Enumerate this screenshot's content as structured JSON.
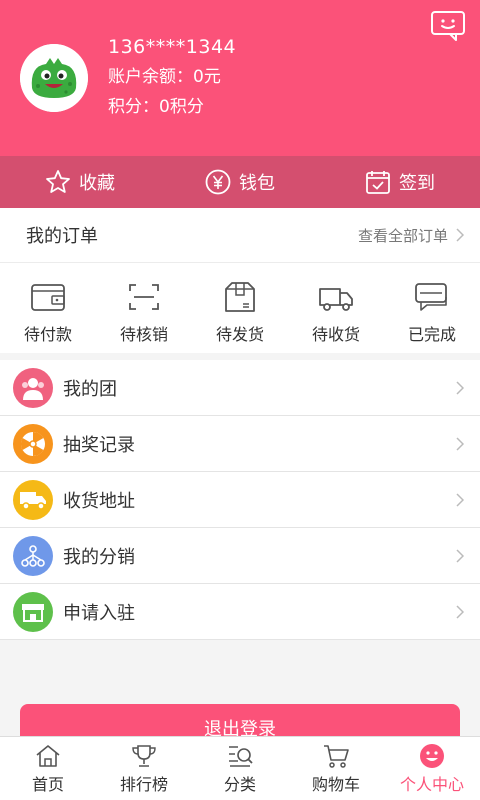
{
  "header": {
    "phone": "136****1344",
    "balance": "账户余额：0元",
    "points": "积分：0积分"
  },
  "quickbar": {
    "favorites": "收藏",
    "wallet": "钱包",
    "checkin": "签到"
  },
  "orders": {
    "title": "我的订单",
    "view_all": "查看全部订单",
    "statuses": [
      "待付款",
      "待核销",
      "待发货",
      "待收货",
      "已完成"
    ]
  },
  "menu": {
    "items": [
      "我的团",
      "抽奖记录",
      "收货地址",
      "我的分销",
      "申请入驻"
    ]
  },
  "logout_label": "退出登录",
  "tabbar": {
    "tabs": [
      "首页",
      "排行榜",
      "分类",
      "购物车",
      "个人中心"
    ],
    "active": "个人中心"
  },
  "colors": {
    "brand": "#fb5279",
    "quickbar": "#d44f6f",
    "group_icon": "#f0617f",
    "lottery_icon": "#f7941d",
    "address_icon": "#f5b916",
    "distribution_icon": "#6f98e9",
    "apply_icon": "#5ec04b"
  }
}
